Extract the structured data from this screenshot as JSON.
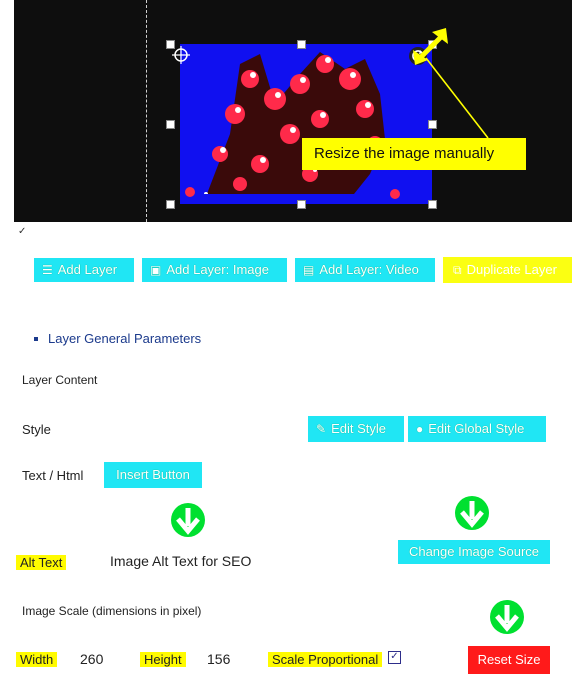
{
  "canvas": {
    "tooltip_text": "Resize the image manually"
  },
  "toolbar": {
    "add_layer": "Add Layer",
    "add_layer_image": "Add Layer: Image",
    "add_layer_video": "Add Layer: Video",
    "duplicate_layer": "Duplicate Layer"
  },
  "section": {
    "title": "Layer General Parameters"
  },
  "form": {
    "layer_content_label": "Layer Content",
    "style_label": "Style",
    "edit_style_button": "Edit Style",
    "edit_global_style_button": "Edit Global Style",
    "text_html_label": "Text / Html",
    "insert_button": "Insert Button",
    "alt_text_label": "Alt Text",
    "alt_text_value": "Image Alt Text for SEO",
    "change_image_source_button": "Change Image Source",
    "image_scale_label": "Image Scale (dimensions in pixel)",
    "width_label": "Width",
    "width_value": "260",
    "height_label": "Height",
    "height_value": "156",
    "scale_proportional_label": "Scale Proportional",
    "scale_proportional_checked": true,
    "reset_size_button": "Reset Size"
  },
  "colors": {
    "highlight": "#fffb00",
    "cyan_button": "#20e6f4",
    "duplicate_button": "#fbff12",
    "reset_button": "#ff1a1a",
    "arrow_green": "#00e030"
  }
}
